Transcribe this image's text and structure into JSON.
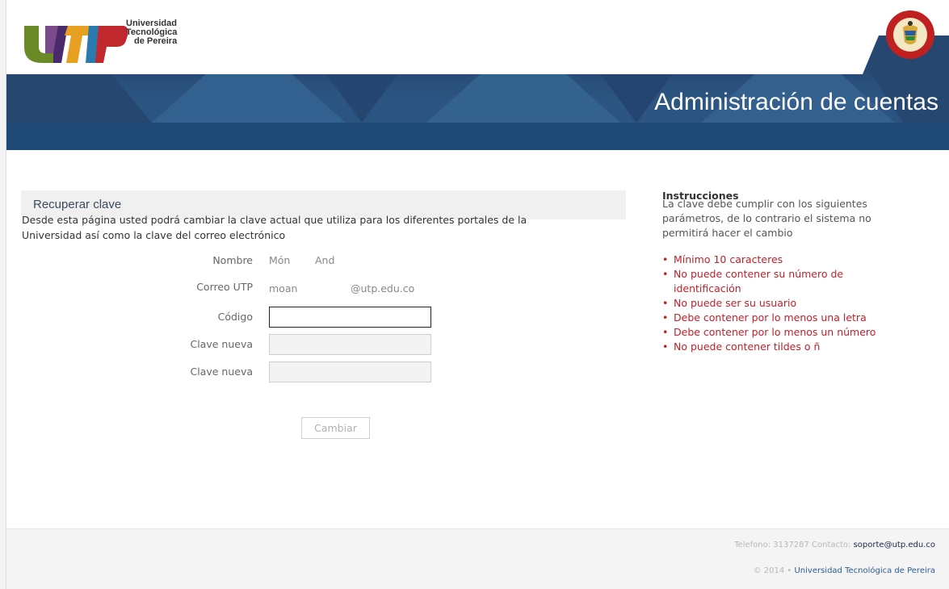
{
  "header": {
    "logo_text": [
      "Universidad",
      "Tecnológica",
      "de Pereira"
    ],
    "app_title": "Administración de cuentas",
    "colors": {
      "banner": "#2b5380",
      "stripe": "#1f4a78"
    }
  },
  "panel": {
    "title": "Recuperar clave",
    "description": [
      "Desde esta página usted podrá cambiar la clave actual que utiliza para los diferentes portales de la",
      "Universidad así como la clave del correo electrónico"
    ]
  },
  "form": {
    "nombre_label": "Nombre",
    "nombre_first": "Món",
    "nombre_last": "And",
    "correo_label": "Correo UTP",
    "correo_user": "moan",
    "correo_domain": "@utp.edu.co",
    "codigo_label": "Código",
    "clave_label_1": "Clave nueva",
    "clave_label_2": "Clave nueva",
    "submit_label": "Cambiar"
  },
  "instructions": {
    "title": "Instrucciones",
    "intro": [
      "La clave debe cumplir con los siguientes",
      "parámetros, de lo contrario el sistema no",
      "permitirá hacer el cambio"
    ],
    "rules": [
      [
        "Mínimo 10 caracteres"
      ],
      [
        "No puede contener su número de",
        "identificación"
      ],
      [
        "No puede ser su usuario"
      ],
      [
        "Debe contener por lo menos una letra"
      ],
      [
        "Debe contener por lo menos un número"
      ],
      [
        "No puede contener tildes o ñ"
      ]
    ],
    "rule_color": "#c0202a"
  },
  "footer": {
    "phone": "Telefono: 3137287",
    "contact_label": "Contacto:",
    "email": "soporte@utp.edu.co",
    "copyright": "© 2014 •",
    "university_link": "Universidad Tecnológica de Pereira"
  },
  "icons": {
    "logo": "utp-logo",
    "seal": "colombia-seal-icon"
  }
}
